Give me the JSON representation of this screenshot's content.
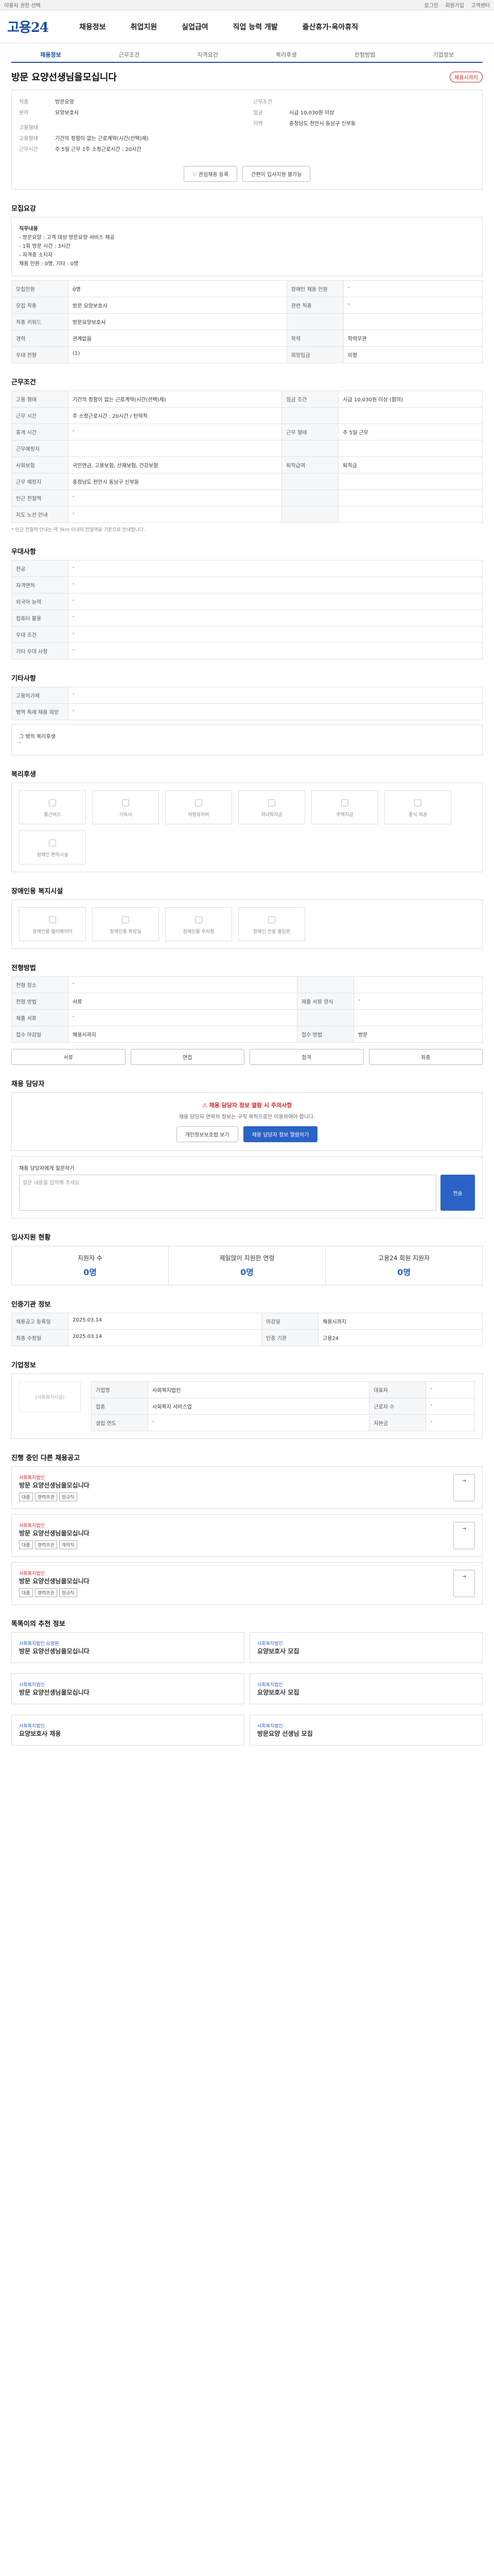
{
  "topbar": {
    "left": "이용자 권한 선택",
    "right": [
      "로그인",
      "회원가입",
      "고객센터"
    ]
  },
  "header": {
    "logo": "고용24",
    "gnb": [
      "채용정보",
      "취업지원",
      "실업급여",
      "직업 능력 개발",
      "출산휴가·육아휴직"
    ]
  },
  "sub": [
    "채용정보",
    "근무조건",
    "자격요건",
    "복리후생",
    "전형방법",
    "기업정보"
  ],
  "job": {
    "title": "방문 요양선생님을모십니다",
    "badge": "채용시까지"
  },
  "summary": {
    "left": [
      {
        "k": "직종",
        "v": "방문요양"
      },
      {
        "k": "분야",
        "v": "요양보호사"
      }
    ],
    "right": [
      {
        "k": "근무조건",
        "v": ""
      },
      {
        "k": "임금",
        "v": "시급 10,030원 이상"
      },
      {
        "k": "지역",
        "v": "충청남도 천안시 동남구 신부동"
      }
    ],
    "recruit": "고용형태",
    "recruit_items": [
      {
        "k": "고용형태",
        "v": "기간의 정함이 없는 근로계약(시간(선택)제)"
      },
      {
        "k": "근무시간",
        "v": "주 5일 근무 1주 소정근로시간 : 20시간"
      }
    ],
    "btn1": "관심채용 등록",
    "btn2": "간편이 입사지원 불가능"
  },
  "condition": {
    "title": "모집요강",
    "desc": [
      "직무내용",
      "- 방문요양 : 고객 대상 방문요양 서비스 제공",
      "- 1회 방문 시간 : 3시간",
      "- 자격증 소지자",
      "채용 인원 : 0명, 기타 : 0명"
    ],
    "rows": [
      [
        "모집인원",
        "0명",
        "장애인 채용 인원",
        "-"
      ],
      [
        "모집 직종",
        "방문 요양보호사",
        "관련 직종",
        "-"
      ],
      [
        "직종 키워드",
        "방문요양보호사",
        "",
        ""
      ],
      [
        "경력",
        "관계없음",
        "학력",
        "학력무관"
      ],
      [
        "우대 전형",
        "(1)",
        "희망임금",
        "미정"
      ]
    ]
  },
  "work": {
    "title": "근무조건",
    "rows": [
      [
        "고용 형태",
        "기간의 정함이 없는 근로계약(시간(선택)제)",
        "임금 조건",
        "시급 10,030원 이상 (협의)"
      ],
      [
        "근무 시간",
        "주 소정근로시간 : 20시간 / 탄력적",
        "",
        ""
      ],
      [
        "휴게 시간",
        "-",
        "근무 형태",
        "주 5일 근무"
      ],
      [
        "근무예정지",
        "",
        "",
        ""
      ],
      [
        "사회보험",
        "국민연금, 고용보험, 산재보험, 건강보험",
        "퇴직급여",
        "퇴직금"
      ],
      [
        "근무 예정지",
        "충청남도 천안시 동남구 신부동",
        "",
        ""
      ],
      [
        "인근 전철역",
        "-",
        "",
        ""
      ],
      [
        "지도 노선 안내",
        "-",
        "",
        ""
      ]
    ],
    "note": "* 인근 전철역 안내는 약 3km 이내의 전철역을 기준으로 안내합니다."
  },
  "qual": {
    "title": "우대사항",
    "rows": [
      [
        "전공",
        "-"
      ],
      [
        "자격면허",
        "-"
      ],
      [
        "외국어 능력",
        "-"
      ],
      [
        "컴퓨터 활용",
        "-"
      ],
      [
        "우대 조건",
        "-"
      ],
      [
        "기타 우대 사항",
        "-"
      ]
    ]
  },
  "etc": {
    "title": "기타사항",
    "rows": [
      [
        "고용허가제",
        "-"
      ],
      [
        "병역 특례 채용 희망",
        "-"
      ]
    ],
    "extra": "그 밖의 복리후생",
    "extra_v": "-"
  },
  "welfare": {
    "title": "복리후생",
    "items": [
      "통근버스",
      "기숙사",
      "차량유지비",
      "자녀학자금",
      "주택자금",
      "중식 제공",
      "장애인 편의시설"
    ]
  },
  "disabled": {
    "title": "장애인용 복지시설",
    "items": [
      "장애인용 엘리베이터",
      "장애인용 화장실",
      "장애인용 주차장",
      "장애인 전용 출입문"
    ]
  },
  "process": {
    "title": "전형방법",
    "rows": [
      [
        "전형 장소",
        "-",
        "",
        ""
      ],
      [
        "전형 방법",
        "서류",
        "제출 서류 양식",
        "-"
      ],
      [
        "제출 서류",
        "-",
        "",
        ""
      ],
      [
        "접수 마감일",
        "채용시까지",
        "접수 방법",
        "방문"
      ]
    ],
    "steps": [
      "서류",
      "면접",
      "합격",
      "최종"
    ]
  },
  "contact": {
    "title": "채용 담당자",
    "warn": "채용 담당자 정보 열람 시 주의사항",
    "desc": "채용 담당자 연락처 정보는 구직 목적으로만 이용하여야 합니다.",
    "btn1": "개인정보보호법 보기",
    "btn2": "채용 담당자 정보 열람하기",
    "inquiry": "채용 담당자에게 질문하기",
    "placeholder": "질문 내용을 입력해 주세요",
    "send": "전송"
  },
  "stats": {
    "title": "입사지원 현황",
    "items": [
      {
        "k": "지원자 수",
        "v": "0명"
      },
      {
        "k": "제일많이 지원한 연령",
        "v": "0명"
      },
      {
        "k": "고용24 회원 지원자",
        "v": "0명"
      }
    ]
  },
  "info": {
    "title": "인증기관 정보",
    "rows": [
      [
        "채용공고 등록일",
        "2025.03.14",
        "마감일",
        "채용시까지"
      ],
      [
        "최종 수정일",
        "2025.03.14",
        "인증 기관",
        "고용24"
      ]
    ]
  },
  "company": {
    "title": "기업정보",
    "name": "(사회복지시설)",
    "rows": [
      [
        "기업명",
        "사회복지법인",
        "대표자",
        "-"
      ],
      [
        "업종",
        "사회복지 서비스업",
        "근로자 수",
        "-"
      ],
      [
        "설립 연도",
        "-",
        "자본금",
        "-"
      ]
    ]
  },
  "similar": {
    "title": "진행 중인 다른 채용공고",
    "items": [
      {
        "co": "사회복지법인",
        "t": "방문 요양선생님을모십니다",
        "tags": [
          "대졸",
          "경력무관",
          "정규직"
        ]
      },
      {
        "co": "사회복지법인",
        "t": "방문 요양선생님을모십니다",
        "tags": [
          "대졸",
          "경력무관",
          "계약직"
        ]
      },
      {
        "co": "사회복지법인",
        "t": "방문 요양선생님을모십니다",
        "tags": [
          "대졸",
          "경력무관",
          "정규직"
        ]
      }
    ]
  },
  "recommend": {
    "title": "똑똑이의 추천 정보",
    "items": [
      {
        "co": "사회복지법인 요양원",
        "t": "방문 요양선생님을모십니다"
      },
      {
        "co": "사회복지법인",
        "t": "요양보호사 모집"
      },
      {
        "co": "사회복지법인",
        "t": "방문 요양선생님을모십니다"
      },
      {
        "co": "사회복지법인",
        "t": "요양보호사 모집"
      },
      {
        "co": "사회복지법인",
        "t": "요양보호사 채용"
      },
      {
        "co": "사회복지법인",
        "t": "방문요양 선생님 모집"
      }
    ]
  }
}
